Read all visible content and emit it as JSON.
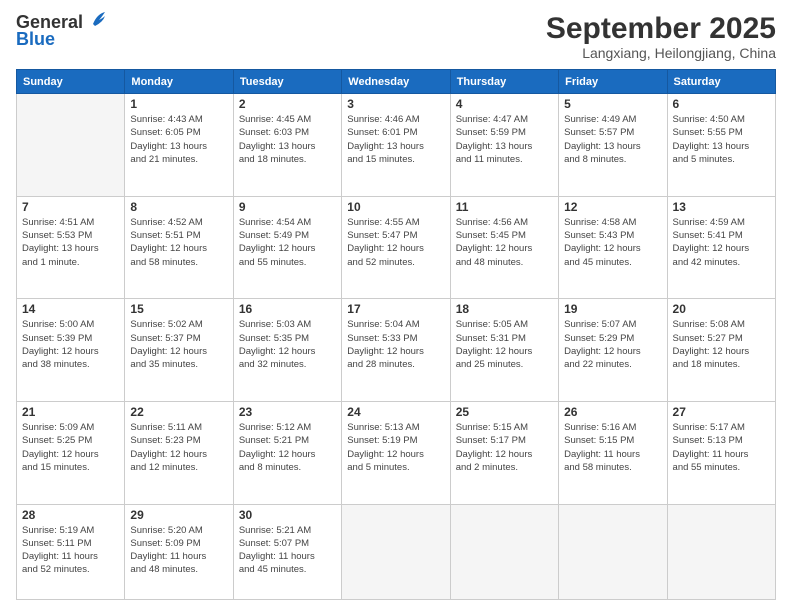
{
  "logo": {
    "line1": "General",
    "line2": "Blue"
  },
  "title": "September 2025",
  "location": "Langxiang, Heilongjiang, China",
  "days_of_week": [
    "Sunday",
    "Monday",
    "Tuesday",
    "Wednesday",
    "Thursday",
    "Friday",
    "Saturday"
  ],
  "weeks": [
    [
      {
        "day": "",
        "info": ""
      },
      {
        "day": "1",
        "info": "Sunrise: 4:43 AM\nSunset: 6:05 PM\nDaylight: 13 hours\nand 21 minutes."
      },
      {
        "day": "2",
        "info": "Sunrise: 4:45 AM\nSunset: 6:03 PM\nDaylight: 13 hours\nand 18 minutes."
      },
      {
        "day": "3",
        "info": "Sunrise: 4:46 AM\nSunset: 6:01 PM\nDaylight: 13 hours\nand 15 minutes."
      },
      {
        "day": "4",
        "info": "Sunrise: 4:47 AM\nSunset: 5:59 PM\nDaylight: 13 hours\nand 11 minutes."
      },
      {
        "day": "5",
        "info": "Sunrise: 4:49 AM\nSunset: 5:57 PM\nDaylight: 13 hours\nand 8 minutes."
      },
      {
        "day": "6",
        "info": "Sunrise: 4:50 AM\nSunset: 5:55 PM\nDaylight: 13 hours\nand 5 minutes."
      }
    ],
    [
      {
        "day": "7",
        "info": "Sunrise: 4:51 AM\nSunset: 5:53 PM\nDaylight: 13 hours\nand 1 minute."
      },
      {
        "day": "8",
        "info": "Sunrise: 4:52 AM\nSunset: 5:51 PM\nDaylight: 12 hours\nand 58 minutes."
      },
      {
        "day": "9",
        "info": "Sunrise: 4:54 AM\nSunset: 5:49 PM\nDaylight: 12 hours\nand 55 minutes."
      },
      {
        "day": "10",
        "info": "Sunrise: 4:55 AM\nSunset: 5:47 PM\nDaylight: 12 hours\nand 52 minutes."
      },
      {
        "day": "11",
        "info": "Sunrise: 4:56 AM\nSunset: 5:45 PM\nDaylight: 12 hours\nand 48 minutes."
      },
      {
        "day": "12",
        "info": "Sunrise: 4:58 AM\nSunset: 5:43 PM\nDaylight: 12 hours\nand 45 minutes."
      },
      {
        "day": "13",
        "info": "Sunrise: 4:59 AM\nSunset: 5:41 PM\nDaylight: 12 hours\nand 42 minutes."
      }
    ],
    [
      {
        "day": "14",
        "info": "Sunrise: 5:00 AM\nSunset: 5:39 PM\nDaylight: 12 hours\nand 38 minutes."
      },
      {
        "day": "15",
        "info": "Sunrise: 5:02 AM\nSunset: 5:37 PM\nDaylight: 12 hours\nand 35 minutes."
      },
      {
        "day": "16",
        "info": "Sunrise: 5:03 AM\nSunset: 5:35 PM\nDaylight: 12 hours\nand 32 minutes."
      },
      {
        "day": "17",
        "info": "Sunrise: 5:04 AM\nSunset: 5:33 PM\nDaylight: 12 hours\nand 28 minutes."
      },
      {
        "day": "18",
        "info": "Sunrise: 5:05 AM\nSunset: 5:31 PM\nDaylight: 12 hours\nand 25 minutes."
      },
      {
        "day": "19",
        "info": "Sunrise: 5:07 AM\nSunset: 5:29 PM\nDaylight: 12 hours\nand 22 minutes."
      },
      {
        "day": "20",
        "info": "Sunrise: 5:08 AM\nSunset: 5:27 PM\nDaylight: 12 hours\nand 18 minutes."
      }
    ],
    [
      {
        "day": "21",
        "info": "Sunrise: 5:09 AM\nSunset: 5:25 PM\nDaylight: 12 hours\nand 15 minutes."
      },
      {
        "day": "22",
        "info": "Sunrise: 5:11 AM\nSunset: 5:23 PM\nDaylight: 12 hours\nand 12 minutes."
      },
      {
        "day": "23",
        "info": "Sunrise: 5:12 AM\nSunset: 5:21 PM\nDaylight: 12 hours\nand 8 minutes."
      },
      {
        "day": "24",
        "info": "Sunrise: 5:13 AM\nSunset: 5:19 PM\nDaylight: 12 hours\nand 5 minutes."
      },
      {
        "day": "25",
        "info": "Sunrise: 5:15 AM\nSunset: 5:17 PM\nDaylight: 12 hours\nand 2 minutes."
      },
      {
        "day": "26",
        "info": "Sunrise: 5:16 AM\nSunset: 5:15 PM\nDaylight: 11 hours\nand 58 minutes."
      },
      {
        "day": "27",
        "info": "Sunrise: 5:17 AM\nSunset: 5:13 PM\nDaylight: 11 hours\nand 55 minutes."
      }
    ],
    [
      {
        "day": "28",
        "info": "Sunrise: 5:19 AM\nSunset: 5:11 PM\nDaylight: 11 hours\nand 52 minutes."
      },
      {
        "day": "29",
        "info": "Sunrise: 5:20 AM\nSunset: 5:09 PM\nDaylight: 11 hours\nand 48 minutes."
      },
      {
        "day": "30",
        "info": "Sunrise: 5:21 AM\nSunset: 5:07 PM\nDaylight: 11 hours\nand 45 minutes."
      },
      {
        "day": "",
        "info": ""
      },
      {
        "day": "",
        "info": ""
      },
      {
        "day": "",
        "info": ""
      },
      {
        "day": "",
        "info": ""
      }
    ]
  ]
}
